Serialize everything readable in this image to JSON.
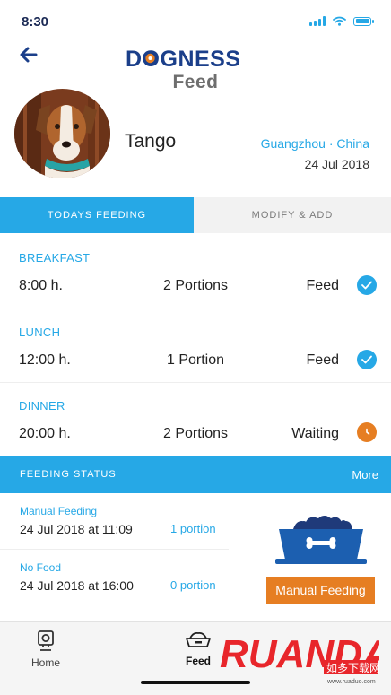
{
  "status_bar": {
    "time": "8:30",
    "signal_icon": "signal-icon",
    "wifi_icon": "wifi-icon",
    "battery_icon": "battery-icon"
  },
  "header": {
    "back_icon": "arrow-left-icon",
    "logo_text": "DOGNESS",
    "title": "Feed"
  },
  "pet": {
    "name": "Tango",
    "location": "Guangzhou · China",
    "date": "24 Jul 2018"
  },
  "tabs": [
    {
      "label": "TODAYS FEEDING",
      "active": true
    },
    {
      "label": "MODIFY & ADD",
      "active": false
    }
  ],
  "meals": [
    {
      "name": "BREAKFAST",
      "time": "8:00 h.",
      "portion": "2 Portions",
      "status": "Feed",
      "icon": "check-circle-icon"
    },
    {
      "name": "LUNCH",
      "time": "12:00 h.",
      "portion": "1 Portion",
      "status": "Feed",
      "icon": "check-circle-icon"
    },
    {
      "name": "DINNER",
      "time": "20:00 h.",
      "portion": "2 Portions",
      "status": "Waiting",
      "icon": "clock-icon"
    }
  ],
  "feeding_status": {
    "title": "FEEDING STATUS",
    "more": "More",
    "entries": [
      {
        "type": "Manual Feeding",
        "date": "24 Jul 2018 at 11:09",
        "portion": "1 portion"
      },
      {
        "type": "No Food",
        "date": "24 Jul 2018 at 16:00",
        "portion": "0 portion"
      }
    ],
    "bowl_icon": "food-bowl-icon",
    "manual_button": "Manual Feeding"
  },
  "bottom_nav": [
    {
      "label": "Home",
      "icon": "camera-icon",
      "active": false
    },
    {
      "label": "Feed",
      "icon": "bowl-icon",
      "active": true
    }
  ],
  "watermark": {
    "logo": "RUANDAO",
    "cn": "如多下载网",
    "url": "www.ruaduo.com"
  },
  "colors": {
    "accent": "#26a8e6",
    "orange": "#e67e22",
    "navy": "#1b3f8a"
  }
}
